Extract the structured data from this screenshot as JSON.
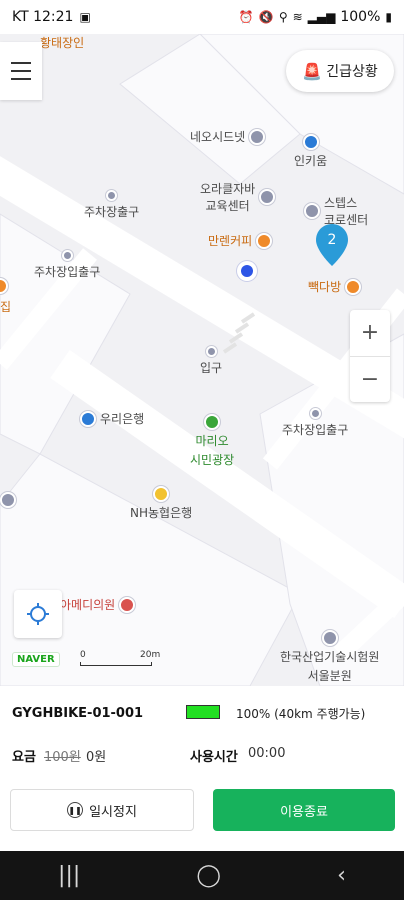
{
  "status_bar": {
    "carrier_time": "KT 12:21",
    "battery": "100%"
  },
  "map": {
    "emergency_label": "긴급상황",
    "pois": {
      "top_cut": "황태장인",
      "neo": "네오시드넷",
      "inkiung": "인키움",
      "oracle_1": "오라클자바",
      "oracle_2": "교육센터",
      "steps_1": "스텝스",
      "steps_2": "코로센터",
      "parking_1": "주차장출구",
      "manren": "만렌커피",
      "parking_2": "주차장입출구",
      "left_cut": "집",
      "baekdabang": "빽다방",
      "entrance": "입구",
      "woori": "우리은행",
      "marionette_1": "마리오",
      "marionette_2": "시민광장",
      "parking_3": "주차장입출구",
      "nh": "NH농협은행",
      "amedi": "아메디의원",
      "kitech_1": "한국산업기술시험원",
      "kitech_2": "서울분원"
    },
    "cluster_count": "2",
    "zoom_in": "+",
    "zoom_out": "−",
    "naver": "NAVER",
    "scale_0": "0",
    "scale_1": "20m"
  },
  "panel": {
    "bike_id": "GYGHBIKE-01-001",
    "battery_text": "100% (40km 주행가능)",
    "fee_label": "요금",
    "fee_original": "100원",
    "fee_current": "0원",
    "time_label": "사용시간",
    "time_value": "00:00",
    "pause_label": "일시정지",
    "end_label": "이용종료"
  },
  "nav": {
    "recents": "|||",
    "home": "◯",
    "back": "‹"
  }
}
